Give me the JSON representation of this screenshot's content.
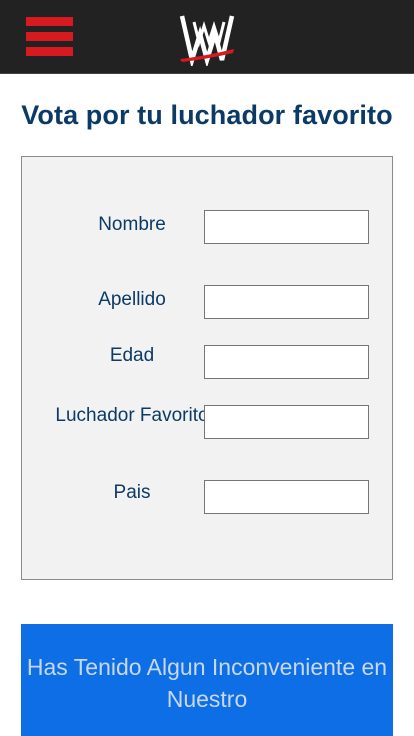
{
  "header": {
    "menu_icon": "hamburger-menu-icon",
    "logo_icon": "wwe-logo",
    "accent_color": "#d71920",
    "background_color": "#222222"
  },
  "page": {
    "title": "Vota por tu luchador favorito"
  },
  "form": {
    "fields": [
      {
        "label": "Nombre",
        "value": ""
      },
      {
        "label": "Apellido",
        "value": ""
      },
      {
        "label": "Edad",
        "value": ""
      },
      {
        "label": "Luchador Favorito",
        "value": ""
      },
      {
        "label": "Pais",
        "value": ""
      }
    ]
  },
  "banner": {
    "text": "Has Tenido Algun Inconveniente en Nuestro",
    "color": "#0d6ee6"
  }
}
